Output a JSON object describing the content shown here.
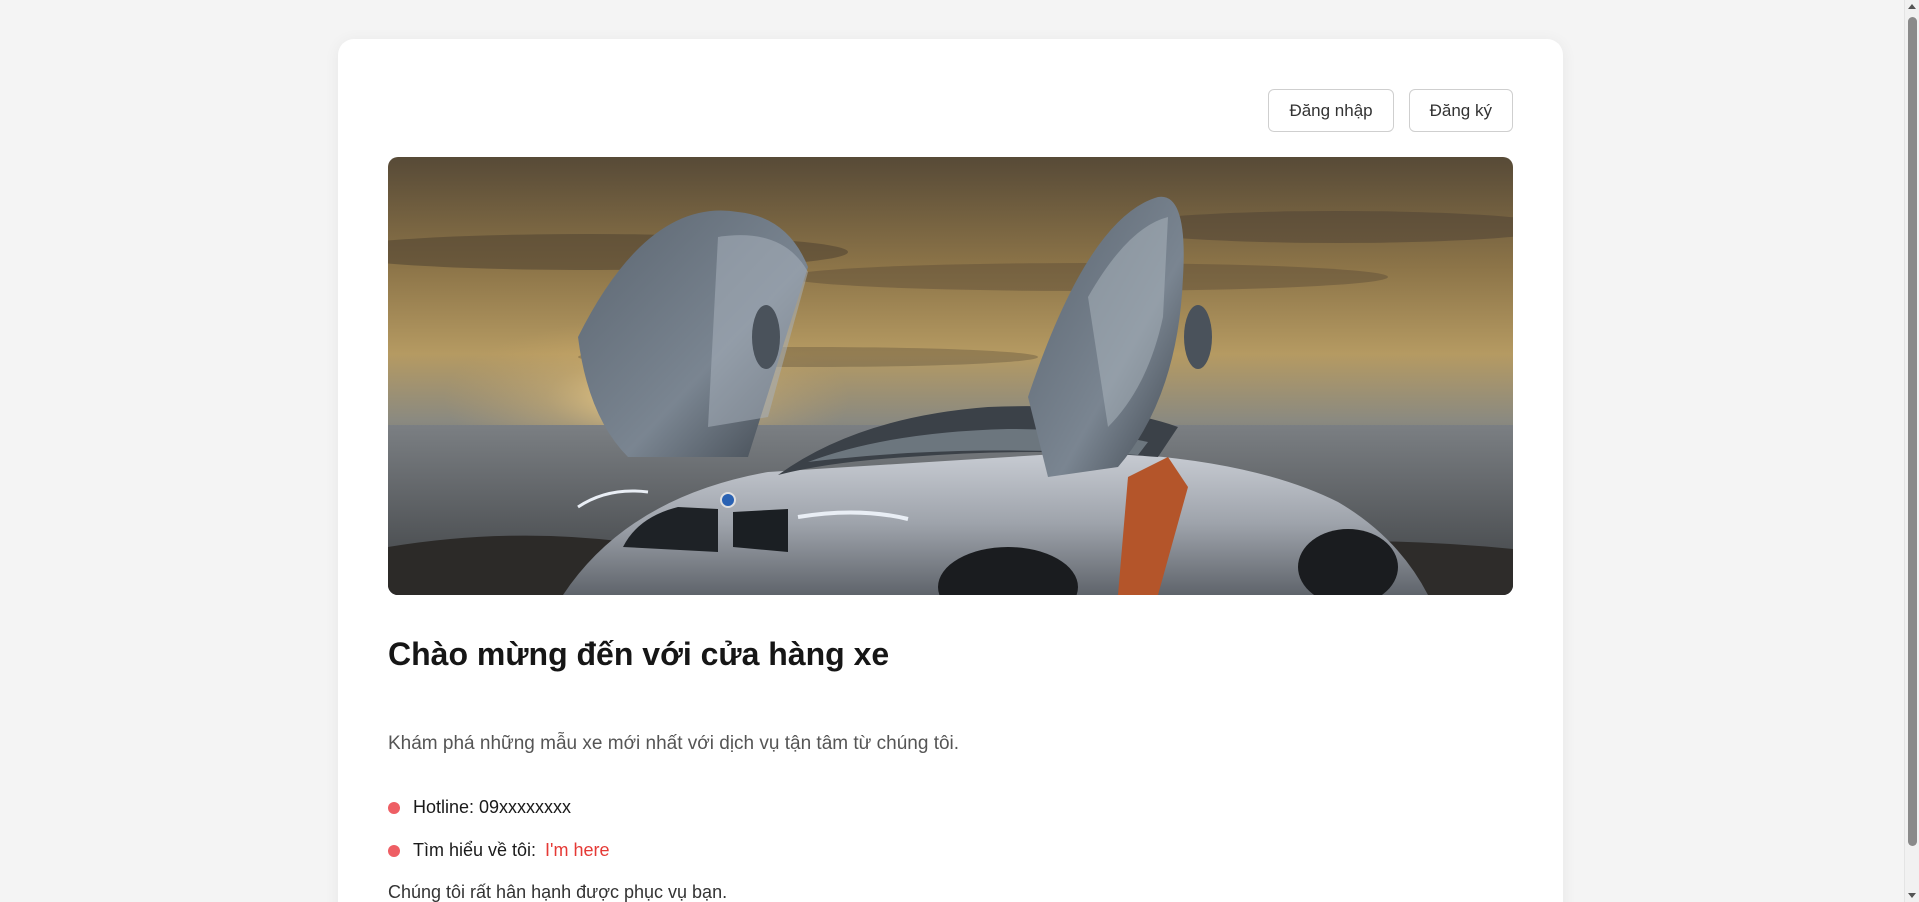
{
  "header": {
    "login_label": "Đăng nhập",
    "register_label": "Đăng ký"
  },
  "hero": {
    "image_description_icon": "car-photo"
  },
  "main": {
    "title": "Chào mừng đến với cửa hàng xe",
    "subtitle": "Khám phá những mẫu xe mới nhất với dịch vụ tận tâm từ chúng tôi.",
    "info": [
      {
        "text": "Hotline: 09xxxxxxxx"
      },
      {
        "text": "Tìm hiểu về tôi:",
        "link_label": "I'm here"
      }
    ],
    "closing": "Chúng tôi rất hân hạnh được phục vụ bạn."
  },
  "colors": {
    "background": "#f4f4f4",
    "card": "#ffffff",
    "bullet": "#ee5e64",
    "link": "#e53935"
  }
}
